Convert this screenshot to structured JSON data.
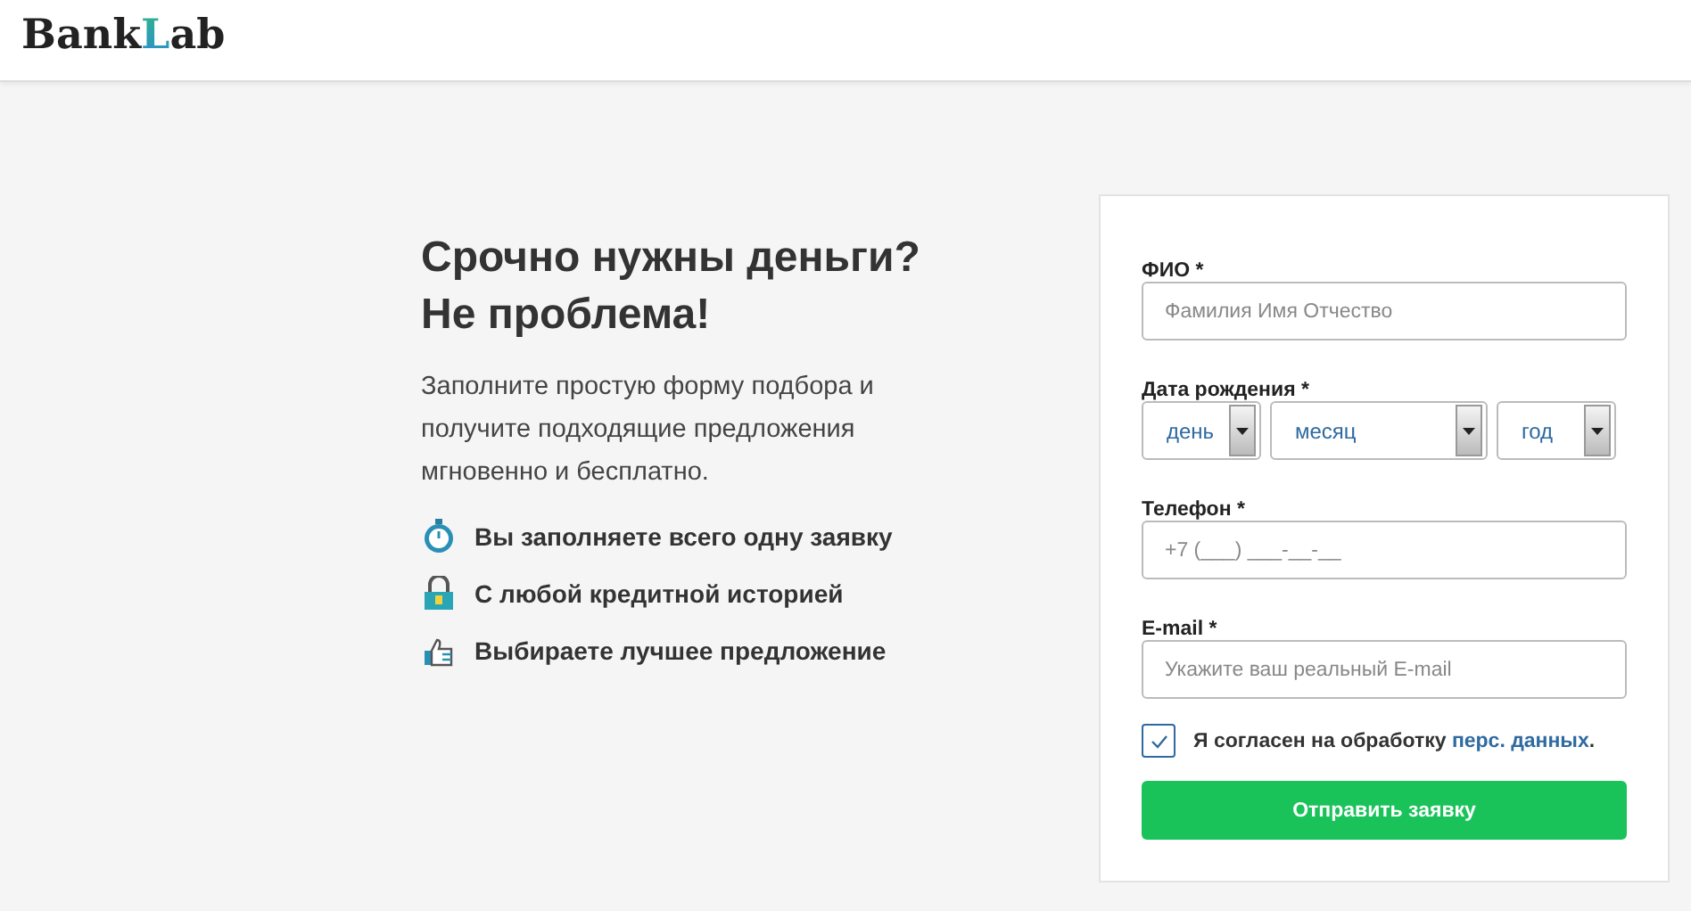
{
  "header": {
    "logo": [
      {
        "text": "Bank",
        "accent": false
      },
      {
        "text": "L",
        "accent": true
      },
      {
        "text": "ab",
        "accent": false
      }
    ]
  },
  "promo": {
    "title_lines": [
      "Срочно нужны деньги?",
      "Не проблема!"
    ],
    "text": "Заполните простую форму подбора и получите подходящие предложения мгновенно и бесплатно.",
    "features": [
      {
        "kind": "stopwatch",
        "text": "Вы заполняете всего одну заявку"
      },
      {
        "kind": "lock",
        "text": "С любой кредитной историей"
      },
      {
        "kind": "thumb",
        "text": "Выбираете лучшее предложение"
      }
    ]
  },
  "form": {
    "name": {
      "label": "ФИО *",
      "placeholder": "Фамилия Имя Отчество"
    },
    "birth_date": {
      "label": "Дата рождения *",
      "selects": [
        {
          "value": "день"
        },
        {
          "value": "месяц"
        },
        {
          "value": "год"
        }
      ]
    },
    "phone": {
      "label": "Телефон *",
      "placeholder": "+7 (___) ___-__-__"
    },
    "email": {
      "label": "E-mail *",
      "placeholder": "Укажите ваш реальный E-mail"
    },
    "consent": {
      "checked": true,
      "text": "Я согласен на обработку ",
      "link": "перс. данных",
      "after": "."
    },
    "submit": "Отправить заявку"
  }
}
